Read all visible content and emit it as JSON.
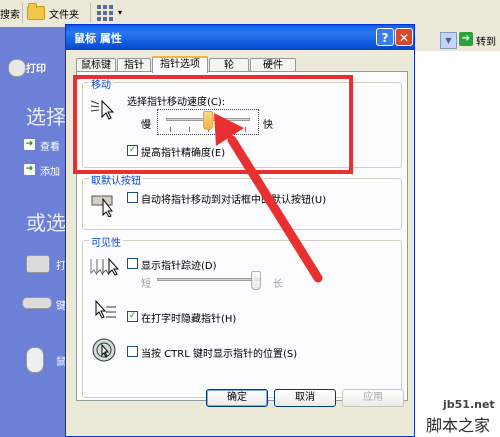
{
  "explorer": {
    "search_label": "搜索",
    "folders_label": "文件夹",
    "go_label": "转到",
    "left_items": [
      {
        "label": "打印"
      },
      {
        "heading": "选择"
      },
      {
        "label": "查看"
      },
      {
        "label": "添加"
      },
      {
        "heading": "或选"
      },
      {
        "label": "打"
      },
      {
        "label": "键"
      },
      {
        "label": "鼠"
      }
    ]
  },
  "dialog": {
    "title": "鼠标 属性",
    "help_glyph": "?",
    "close_glyph": "✕",
    "tabs": [
      {
        "label": "鼠标键"
      },
      {
        "label": "指针"
      },
      {
        "label": "指针选项",
        "active": true
      },
      {
        "label": "轮"
      },
      {
        "label": "硬件"
      }
    ],
    "motion": {
      "title": "移动",
      "speed_label": "选择指针移动速度(C):",
      "slow_label": "慢",
      "fast_label": "快",
      "speed_value": 0.5,
      "precision_label": "提高指针精确度(E)",
      "precision_checked": true
    },
    "snap_to": {
      "title": "取默认按钮",
      "label": "自动将指针移动到对话框中的默认按钮(U)",
      "checked": false
    },
    "visibility": {
      "title": "可见性",
      "trails_label": "显示指针踪迹(D)",
      "trails_checked": false,
      "short_label": "短",
      "long_label": "长",
      "hide_label": "在打字时隐藏指针(H)",
      "hide_checked": true,
      "ctrl_label": "当按 CTRL 键时显示指针的位置(S)",
      "ctrl_checked": false
    },
    "buttons": {
      "ok": "确定",
      "cancel": "取消",
      "apply": "应用"
    }
  },
  "watermark": {
    "domain": "jb51.net",
    "name": "脚本之家"
  },
  "colors": {
    "highlight": "#e93030",
    "arrow": "#e93030",
    "xp_title": "#0a5fe6",
    "group_title": "#0046d5"
  }
}
